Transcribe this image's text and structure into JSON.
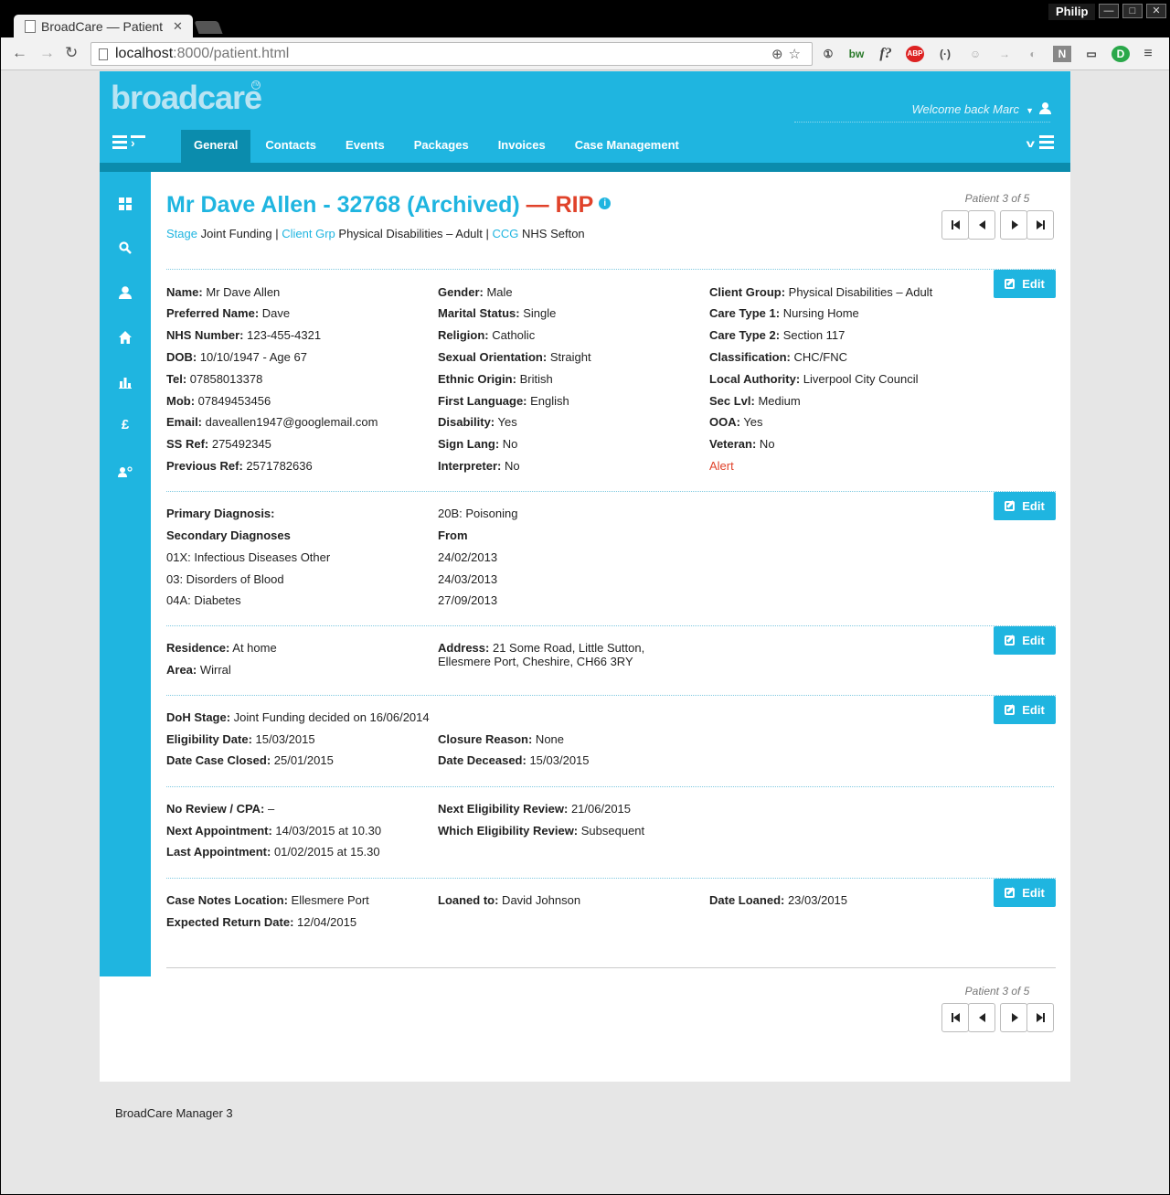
{
  "browser": {
    "tab_title": "BroadCare — Patient",
    "tab_close": "✕",
    "user": "Philip",
    "url_host": "localhost",
    "url_path": ":8000/patient.html",
    "window_buttons": [
      "—",
      "□",
      "✕"
    ],
    "extensions": [
      "①",
      "bw",
      "f?",
      "ABP",
      "(·)",
      "☺",
      "→",
      "◐",
      "N",
      "▭",
      "D",
      "≡"
    ]
  },
  "header": {
    "logo": "broadcare",
    "logo_mark": "TM",
    "welcome": "Welcome back Marc",
    "nav": [
      {
        "label": "General",
        "active": true
      },
      {
        "label": "Contacts"
      },
      {
        "label": "Events"
      },
      {
        "label": "Packages"
      },
      {
        "label": "Invoices"
      },
      {
        "label": "Case Management"
      }
    ]
  },
  "sidebar": {
    "icons": [
      "dashboard-icon",
      "search-icon",
      "user-icon",
      "home-icon",
      "bar-chart-icon",
      "pound-icon",
      "user-settings-icon"
    ],
    "pound_glyph": "£"
  },
  "patient": {
    "title_main": "Mr Dave Allen - 32768 (Archived)",
    "title_rip": " — RIP",
    "info_glyph": "i",
    "stage_label": "Stage",
    "stage_value": " Joint Funding | ",
    "client_grp_label": "Client Grp",
    "client_grp_value": " Physical Disabilities – Adult | ",
    "ccg_label": "CCG",
    "ccg_value": " NHS Sefton"
  },
  "pager": {
    "label": "Patient 3 of 5"
  },
  "edit_label": "Edit",
  "personal": {
    "col1": [
      {
        "label": "Name:",
        "value": " Mr Dave Allen"
      },
      {
        "label": "Preferred Name:",
        "value": " Dave"
      },
      {
        "label": "NHS Number:",
        "value": " 123-455-4321"
      },
      {
        "label": "DOB:",
        "value": " 10/10/1947 - Age 67"
      },
      {
        "label": "Tel:",
        "value": " 07858013378"
      },
      {
        "label": "Mob:",
        "value": " 07849453456"
      },
      {
        "label": "Email:",
        "value": " daveallen1947@googlemail.com"
      },
      {
        "label": "SS Ref:",
        "value": " 275492345"
      },
      {
        "label": "Previous Ref:",
        "value": " 2571782636"
      }
    ],
    "col2": [
      {
        "label": "Gender:",
        "value": " Male"
      },
      {
        "label": "Marital Status:",
        "value": " Single"
      },
      {
        "label": "Religion:",
        "value": " Catholic"
      },
      {
        "label": "Sexual Orientation:",
        "value": " Straight"
      },
      {
        "label": "Ethnic Origin:",
        "value": " British"
      },
      {
        "label": "First Language:",
        "value": " English"
      },
      {
        "label": "Disability:",
        "value": " Yes"
      },
      {
        "label": "Sign Lang:",
        "value": " No"
      },
      {
        "label": "Interpreter:",
        "value": " No"
      }
    ],
    "col3": [
      {
        "label": "Client Group:",
        "value": " Physical Disabilities – Adult"
      },
      {
        "label": "Care Type 1:",
        "value": " Nursing Home"
      },
      {
        "label": "Care Type 2:",
        "value": " Section 117"
      },
      {
        "label": "Classification:",
        "value": " CHC/FNC"
      },
      {
        "label": "Local Authority:",
        "value": " Liverpool City Council"
      },
      {
        "label": "Sec Lvl:",
        "value": " Medium"
      },
      {
        "label": "OOA:",
        "value": " Yes"
      },
      {
        "label": "Veteran:",
        "value": " No"
      }
    ],
    "alert": "Alert"
  },
  "diagnosis": {
    "primary_label": "Primary Diagnosis:",
    "primary_value": "20B: Poisoning",
    "secondary_label": "Secondary Diagnoses",
    "from_label": "From",
    "secondary": [
      {
        "name": "01X: Infectious Diseases Other",
        "from": "24/02/2013"
      },
      {
        "name": "03: Disorders of Blood",
        "from": "24/03/2013"
      },
      {
        "name": "04A: Diabetes",
        "from": "27/09/2013"
      }
    ]
  },
  "residence": {
    "residence_label": "Residence:",
    "residence_value": " At home",
    "area_label": "Area:",
    "area_value": " Wirral",
    "address_label": "Address:",
    "address_line1": " 21 Some Road, Little Sutton,",
    "address_line2": "Ellesmere Port, Cheshire, CH66 3RY"
  },
  "funding": {
    "doh_label": "DoH Stage:",
    "doh_value": " Joint Funding decided on 16/06/2014",
    "elig_label": "Eligibility Date:",
    "elig_value": " 15/03/2015",
    "closed_label": "Date Case Closed:",
    "closed_value": " 25/01/2015",
    "closure_label": "Closure Reason:",
    "closure_value": " None",
    "deceased_label": "Date Deceased:",
    "deceased_value": " 15/03/2015"
  },
  "review": {
    "noreview_label": "No Review / CPA:",
    "noreview_value": " –",
    "nextappt_label": "Next Appointment:",
    "nextappt_value": " 14/03/2015 at 10.30",
    "lastappt_label": "Last Appointment:",
    "lastappt_value": " 01/02/2015 at 15.30",
    "nextelig_label": "Next Eligibility Review:",
    "nextelig_value": " 21/06/2015",
    "which_label": "Which Eligibility Review:",
    "which_value": " Subsequent"
  },
  "casenotes": {
    "location_label": "Case Notes Location:",
    "location_value": " Ellesmere Port",
    "return_label": "Expected Return Date:",
    "return_value": " 12/04/2015",
    "loaned_label": "Loaned to:",
    "loaned_value": " David Johnson",
    "dateloaned_label": "Date Loaned:",
    "dateloaned_value": " 23/03/2015"
  },
  "footer": "BroadCare Manager 3",
  "colors": {
    "accent": "#1fb5e0",
    "accent_dark": "#0b8cad",
    "alert": "#e0422a"
  }
}
